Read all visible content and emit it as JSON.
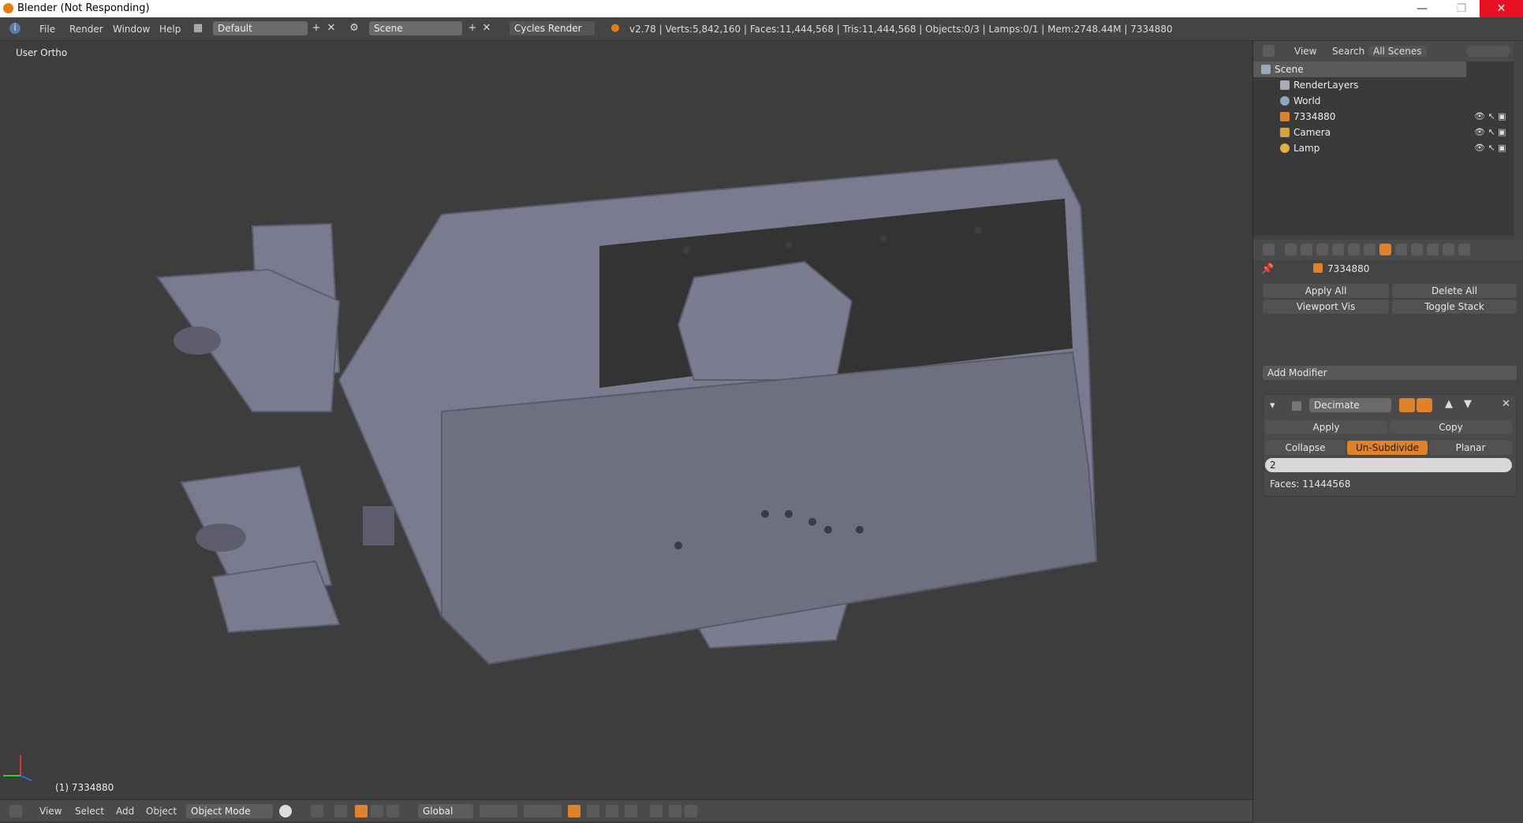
{
  "window": {
    "title": "Blender (Not Responding)",
    "minimize": "—",
    "maximize": "❐",
    "close": "✕"
  },
  "menubar": {
    "items": [
      "File",
      "Render",
      "Window",
      "Help"
    ],
    "screen_layout": "Default",
    "scene": "Scene",
    "render_engine": "Cycles Render",
    "stats": "v2.78 | Verts:5,842,160 | Faces:11,444,568 | Tris:11,444,568 | Objects:0/3 | Lamps:0/1 | Mem:2748.44M | 7334880"
  },
  "viewport": {
    "view_label": "User Ortho",
    "object_label": "(1) 7334880"
  },
  "bottombar": {
    "menus": [
      "View",
      "Select",
      "Add",
      "Object"
    ],
    "mode": "Object Mode",
    "orientation": "Global"
  },
  "outliner": {
    "header": {
      "view": "View",
      "search": "Search",
      "scenes": "All Scenes"
    },
    "rows": [
      {
        "label": "Scene"
      },
      {
        "label": "RenderLayers"
      },
      {
        "label": "World"
      },
      {
        "label": "7334880"
      },
      {
        "label": "Camera"
      },
      {
        "label": "Lamp"
      }
    ]
  },
  "properties": {
    "object_name": "7334880",
    "apply_all": "Apply All",
    "delete_all": "Delete All",
    "viewport_vis": "Viewport Vis",
    "toggle_stack": "Toggle Stack",
    "add_modifier": "Add Modifier",
    "modifier": {
      "name": "Decimate",
      "apply": "Apply",
      "copy": "Copy",
      "modes": [
        "Collapse",
        "Un-Subdivide",
        "Planar"
      ],
      "active_mode": "Un-Subdivide",
      "iterations": "2",
      "faces": "Faces: 11444568"
    }
  },
  "colors": {
    "accent": "#e0822a",
    "viewport_bg": "#3d3d3d",
    "mesh": "#7a7a8e"
  }
}
